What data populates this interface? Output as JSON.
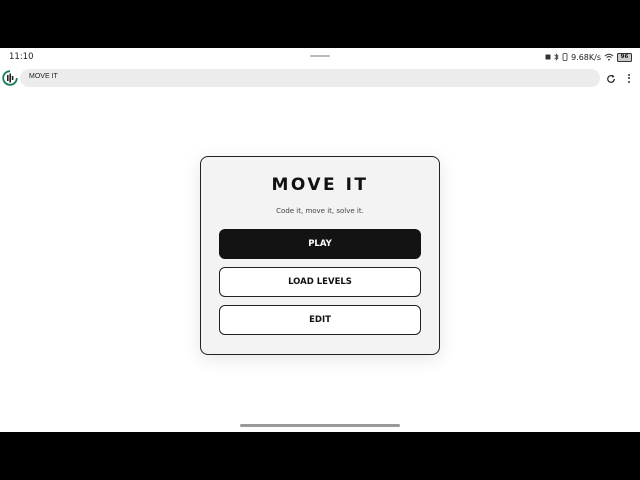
{
  "status_bar": {
    "time": "11:10",
    "net_speed": "9.68K/s",
    "battery_level": "96",
    "icons": [
      "screenshot-icon",
      "bluetooth-icon",
      "vibrate-icon",
      "wifi-icon",
      "battery-icon"
    ]
  },
  "browser": {
    "address_text": "MOVE IT",
    "logo_icon": "app-logo-icon",
    "reload_icon": "reload-icon",
    "menu_icon": "more-vert-icon"
  },
  "card": {
    "title": "MOVE IT",
    "subtitle": "Code it, move it, solve it.",
    "buttons": {
      "play": "PLAY",
      "load_levels": "LOAD LEVELS",
      "edit": "EDIT"
    }
  },
  "colors": {
    "primary_button": "#131313",
    "card_background": "#f3f3f3",
    "page_background": "#ffffff",
    "accent_logo": "#1a7a5c"
  }
}
